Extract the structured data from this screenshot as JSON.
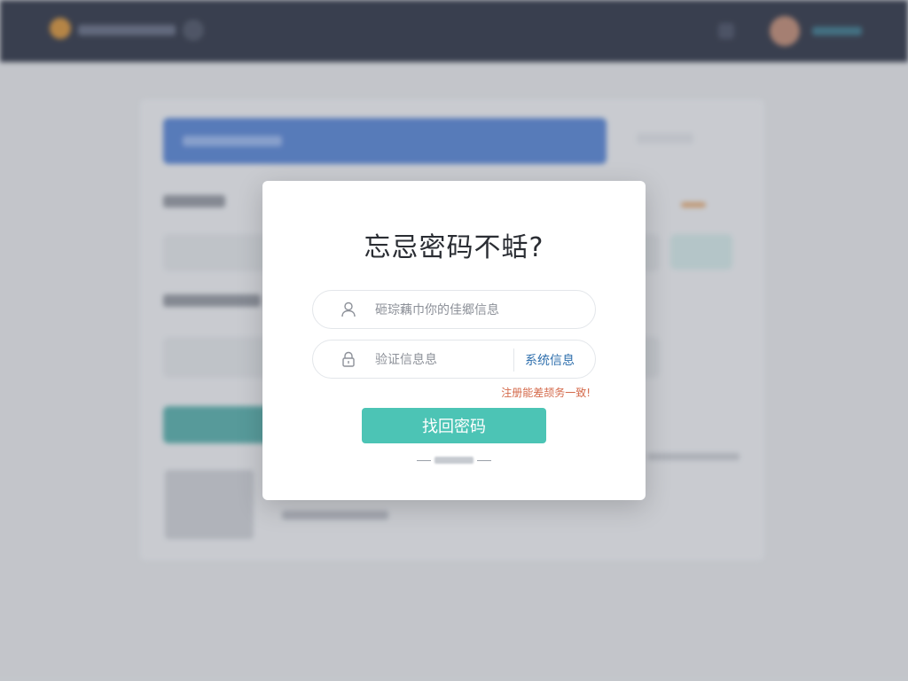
{
  "background": {
    "header": {
      "logo_icon": "app-logo-icon",
      "notification_icon": "bell-icon"
    }
  },
  "dialog": {
    "title": "忘忌密码不蛞?",
    "account_field": {
      "icon": "user-icon",
      "placeholder": "砸琮藕巾你的佳郷信息"
    },
    "code_field": {
      "icon": "lock-icon",
      "placeholder": "验证信息息",
      "action_label": "系统信息"
    },
    "hint": "注册能差颉务一致!",
    "submit_label": "找回密码"
  },
  "colors": {
    "header_bg": "#1f2638",
    "banner": "#4a7bd0",
    "accent_teal": "#4cc4b5",
    "link_blue": "#2f6fad",
    "hint_orange": "#d4694a"
  }
}
